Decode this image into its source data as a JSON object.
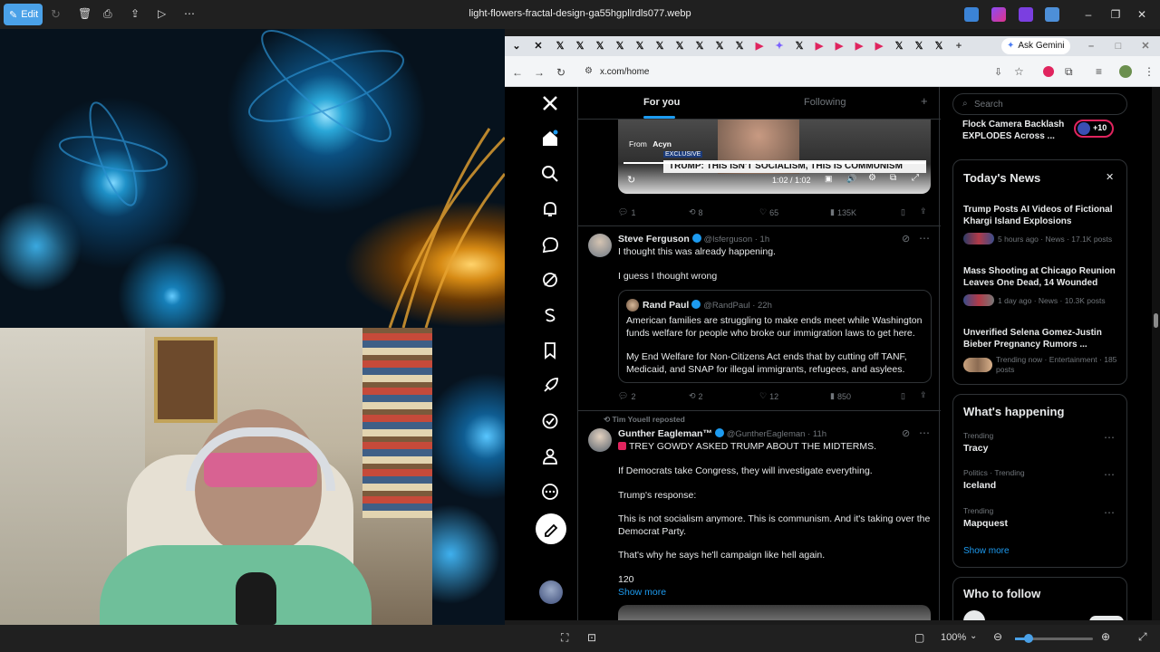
{
  "viewer": {
    "edit_label": "Edit",
    "file_name": "light-flowers-fractal-design-ga55hgpllrdls077.webp",
    "zoom": "100%"
  },
  "browser": {
    "ask_gemini": "Ask Gemini",
    "url": "x.com/home"
  },
  "x": {
    "tabs": {
      "for_you": "For you",
      "following": "Following"
    },
    "video": {
      "from_label": "From",
      "from_name": "Acyn",
      "badge": "EXCLUSIVE",
      "caption": "TRUMP: THIS ISN'T SOCIALISM, THIS IS COMMUNISM",
      "time": "1:02 / 1:02"
    },
    "video_actions": {
      "replies": "1",
      "reposts": "8",
      "likes": "65",
      "views": "135K"
    },
    "post1": {
      "name": "Steve Ferguson",
      "handle": "@lsferguson · 1h",
      "line1": "I thought this was already happening.",
      "line2": "I guess I thought wrong",
      "quote": {
        "name": "Rand Paul",
        "handle": "@RandPaul · 22h",
        "p1": "American families are struggling to make ends meet while Washington funds welfare for people who broke our immigration laws to get here.",
        "p2": "My End Welfare for Non-Citizens Act ends that by cutting off TANF, Medicaid, and SNAP for illegal immigrants, refugees, and asylees."
      },
      "actions": {
        "replies": "2",
        "reposts": "2",
        "likes": "12",
        "views": "850"
      }
    },
    "post2": {
      "repost_label": "Tim Youell reposted",
      "name": "Gunther Eagleman™",
      "handle": "@GuntherEagleman · 11h",
      "l1": "TREY GOWDY ASKED TRUMP ABOUT THE MIDTERMS.",
      "l2": "If Democrats take Congress, they will investigate everything.",
      "l3": "Trump's response:",
      "l4": "This is not socialism anymore. This is communism. And it's taking over the Democrat Party.",
      "l5": "That's why he says he'll campaign like hell again.",
      "l6": "120",
      "show_more": "Show more"
    },
    "sidebar": {
      "search_placeholder": "Search",
      "top_story": "Flock Camera Backlash EXPLODES Across ...",
      "top_story_count": "+10",
      "todays_news": "Today's News",
      "news": [
        {
          "title": "Trump Posts AI Videos of Fictional Khargi Island Explosions",
          "meta": "5 hours ago · News · 17.1K posts"
        },
        {
          "title": "Mass Shooting at Chicago Reunion Leaves One Dead, 14 Wounded",
          "meta": "1 day ago · News · 10.3K posts"
        },
        {
          "title": "Unverified Selena Gomez-Justin Bieber Pregnancy Rumors ...",
          "meta": "Trending now · Entertainment · 185 posts"
        }
      ],
      "whats_happening": "What's happening",
      "trends": [
        {
          "category": "Trending",
          "name": "Tracy"
        },
        {
          "category": "Politics · Trending",
          "name": "Iceland"
        },
        {
          "category": "Trending",
          "name": "Mapquest"
        }
      ],
      "show_more": "Show more",
      "who_to_follow": "Who to follow"
    }
  }
}
